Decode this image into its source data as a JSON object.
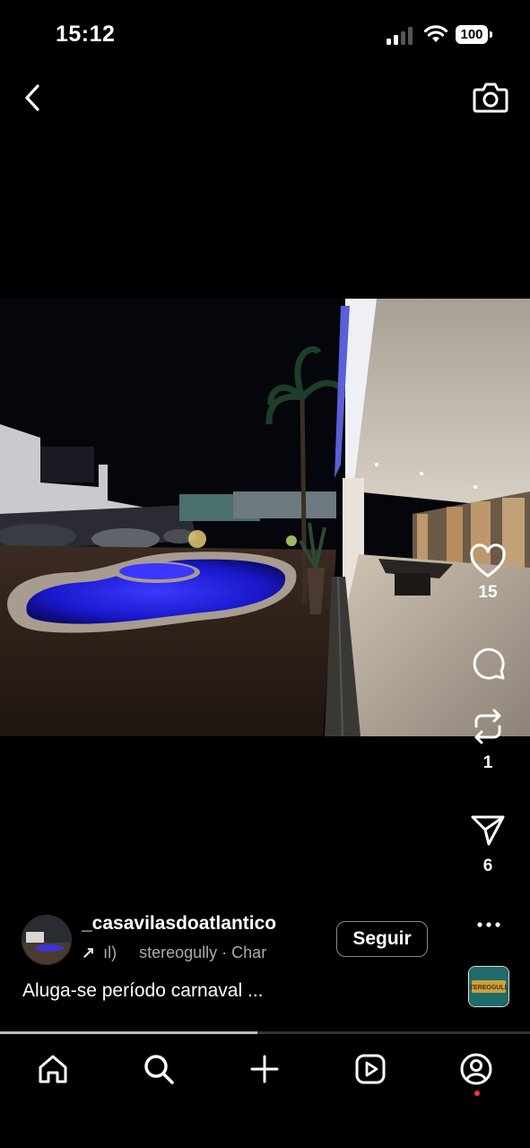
{
  "status_bar": {
    "time": "15:12",
    "battery": "100"
  },
  "post": {
    "username": "_casavilasdoatlantico",
    "audio_prefix": "↗",
    "audio_fragment": "ıl)",
    "audio_text": "stereogully · Char",
    "follow_label": "Seguir",
    "caption": "Aluga-se período carnaval ...",
    "audio_thumb_label": "STEREOGULLY"
  },
  "actions": {
    "likes": "15",
    "reposts": "1",
    "shares": "6"
  },
  "playback_progress": 0.485,
  "icons": [
    "back-icon",
    "camera-icon",
    "heart-icon",
    "comment-icon",
    "repost-icon",
    "send-icon",
    "more-icon",
    "home-icon",
    "search-icon",
    "create-icon",
    "reels-icon",
    "profile-icon"
  ],
  "colors": {
    "background": "#000000",
    "notification_dot": "#ff3040",
    "pool": "#2a2ae0"
  }
}
